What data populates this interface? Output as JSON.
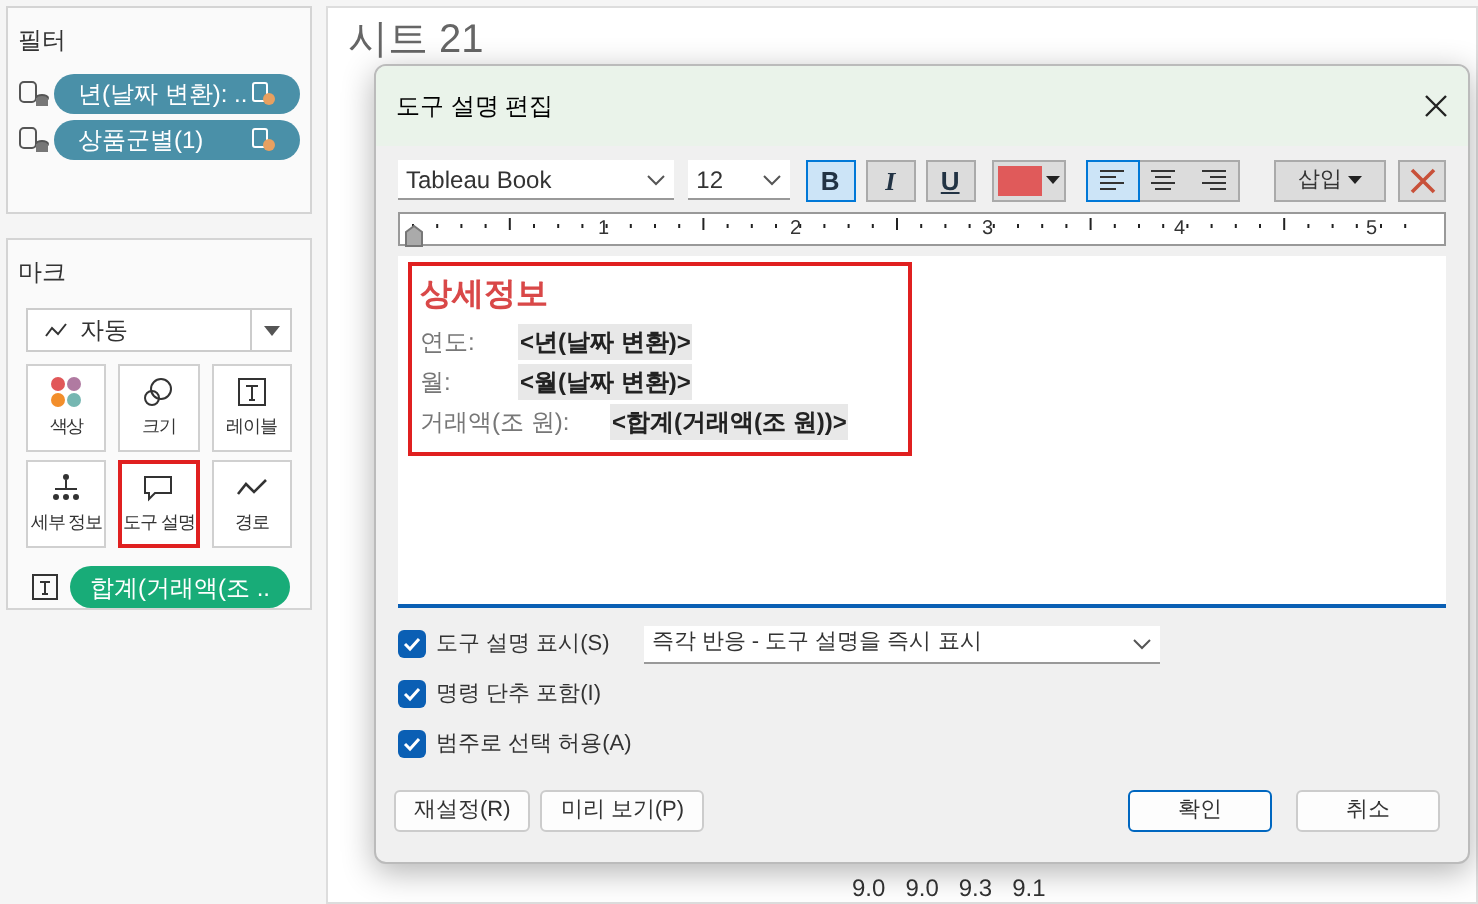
{
  "filters": {
    "title": "필터",
    "pills": [
      {
        "label": "년(날짜 변환): .."
      },
      {
        "label": "상품군별(1)"
      }
    ]
  },
  "marks": {
    "title": "마크",
    "mark_type": "자동",
    "cards": [
      {
        "kind": "color",
        "label": "색상",
        "selected": false
      },
      {
        "kind": "size",
        "label": "크기",
        "selected": false
      },
      {
        "kind": "label",
        "label": "레이블",
        "selected": false
      },
      {
        "kind": "detail",
        "label": "세부 정보",
        "selected": false
      },
      {
        "kind": "tooltip",
        "label": "도구 설명",
        "selected": true
      },
      {
        "kind": "path",
        "label": "경로",
        "selected": false
      }
    ],
    "fields": [
      {
        "label": "합계(거래액(조 .."
      }
    ]
  },
  "sheet": {
    "title": "시트 21",
    "data_labels": [
      "9.0",
      "9.0",
      "9.3",
      "9.1"
    ]
  },
  "dialog": {
    "title": "도구 설명 편집",
    "font": "Tableau Book",
    "size": "12",
    "format_buttons": [
      {
        "kind": "bold",
        "label": "B",
        "selected": true
      },
      {
        "kind": "italic",
        "label": "I",
        "selected": false
      },
      {
        "kind": "underline",
        "label": "U",
        "selected": false
      }
    ],
    "align_buttons": [
      {
        "kind": "left",
        "selected": true
      },
      {
        "kind": "center",
        "selected": false
      },
      {
        "kind": "right",
        "selected": false
      }
    ],
    "insert": "삽입",
    "ruler": [
      "1",
      "2",
      "3",
      "4",
      "5"
    ],
    "content": {
      "heading": "상세정보",
      "lines": [
        {
          "label": "연도:",
          "field": "<년(날짜 변환)>"
        },
        {
          "label": "월:",
          "field": "<월(날짜 변환)>"
        },
        {
          "label": "거래액(조 원):",
          "field": "<합계(거래액(조 원))>"
        }
      ]
    },
    "options": [
      {
        "label": "도구 설명 표시(S)",
        "checked": true
      },
      {
        "label": "명령 단추 포함(I)",
        "checked": true
      },
      {
        "label": "범주로 선택 허용(A)",
        "checked": true
      }
    ],
    "behavior": "즉각 반응 - 도구 설명을 즉시 표시",
    "left_buttons": [
      "재설정(R)",
      "미리 보기(P)"
    ],
    "ok": "확인",
    "cancel": "취소"
  }
}
